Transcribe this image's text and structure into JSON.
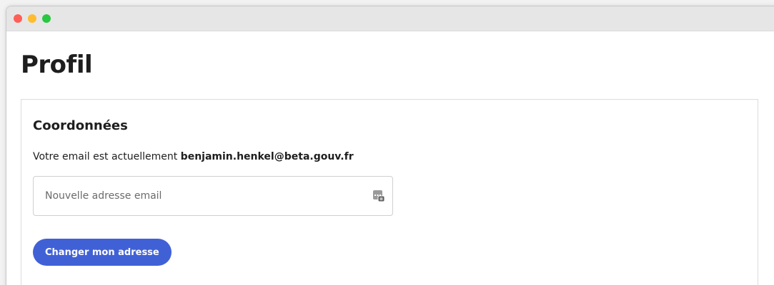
{
  "window": {
    "controls": [
      "close",
      "minimize",
      "maximize"
    ]
  },
  "page": {
    "title": "Profil"
  },
  "contact_card": {
    "title": "Coordonnées",
    "email_prefix": "Votre email est actuellement ",
    "current_email": "benjamin.henkel@beta.gouv.fr",
    "email_input": {
      "value": "",
      "placeholder": "Nouvelle adresse email",
      "icon": "autofill-icon"
    },
    "submit_label": "Changer mon adresse"
  },
  "colors": {
    "accent": "#4061d6",
    "traffic_red": "#ff5f57",
    "traffic_yellow": "#febc2e",
    "traffic_green": "#28c840"
  }
}
